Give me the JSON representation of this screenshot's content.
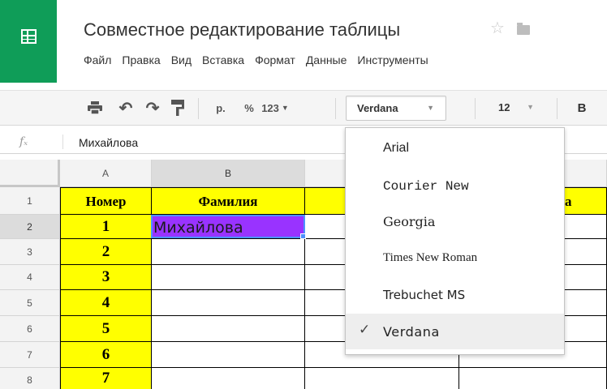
{
  "app": {
    "logo_icon": "sheets-grid-icon",
    "doc_title": "Совместное редактирование таблицы",
    "star_icon": "star-outline-icon",
    "folder_icon": "folder-icon"
  },
  "menu": [
    "Файл",
    "Правка",
    "Вид",
    "Вставка",
    "Формат",
    "Данные",
    "Инструменты"
  ],
  "toolbar": {
    "print_icon": "print-icon",
    "undo_icon": "undo-icon",
    "redo_icon": "redo-icon",
    "paint_format_icon": "paint-format-icon",
    "currency_label": "р.",
    "percent_label": "%",
    "number_format_label": "123",
    "font_value": "Verdana",
    "font_size_value": "12",
    "bold_label": "B"
  },
  "formula_bar": {
    "fx_label": "fx",
    "value": "Михайлова"
  },
  "columns": [
    "A",
    "B"
  ],
  "rows": [
    "1",
    "2",
    "3",
    "4",
    "5",
    "6",
    "7",
    "8"
  ],
  "headers": {
    "a1": "Номер",
    "b1": "Фамилия",
    "d1_fragment": "a"
  },
  "numbers": [
    "1",
    "2",
    "3",
    "4",
    "5",
    "6",
    "7"
  ],
  "cells": {
    "b2": "Михайлова"
  },
  "colors": {
    "logo_green": "#0f9d58",
    "highlight_yellow": "#ffff00",
    "cell_purple": "#9933ff",
    "selection_blue": "#4d90fe"
  },
  "font_dropdown": {
    "items": [
      "Arial",
      "Courier New",
      "Georgia",
      "Times New Roman",
      "Trebuchet MS",
      "Verdana"
    ],
    "selected": "Verdana",
    "check_icon": "checkmark-icon"
  }
}
